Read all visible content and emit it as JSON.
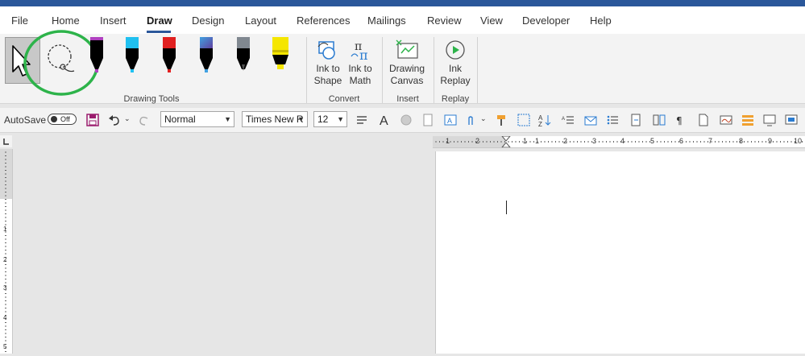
{
  "tabs": [
    "File",
    "Home",
    "Insert",
    "Draw",
    "Design",
    "Layout",
    "References",
    "Mailings",
    "Review",
    "View",
    "Developer",
    "Help"
  ],
  "active_tab": "Draw",
  "ribbon": {
    "groups": {
      "drawing_tools": "Drawing Tools",
      "convert": "Convert",
      "insert": "Insert",
      "replay": "Replay"
    },
    "buttons": {
      "ink_to_shape": [
        "Ink to",
        "Shape"
      ],
      "ink_to_math": [
        "Ink to",
        "Math"
      ],
      "drawing_canvas": [
        "Drawing",
        "Canvas"
      ],
      "ink_replay": [
        "Ink",
        "Replay"
      ]
    },
    "pens": [
      {
        "name": "black-pen",
        "color": "#000000",
        "tip": "#b040c0"
      },
      {
        "name": "cyan-pen",
        "color": "#20c0f0",
        "tip": "#20c0f0"
      },
      {
        "name": "red-pen",
        "color": "#e02020",
        "tip": "#e02020"
      },
      {
        "name": "galaxy-pen",
        "color": "#6050a0",
        "tip": "#40a0e0"
      },
      {
        "name": "pencil",
        "color": "#808890",
        "tip": "#505050"
      },
      {
        "name": "yellow-highlighter",
        "color": "#f5e600",
        "tip": "#f5e600"
      }
    ]
  },
  "qat": {
    "autosave_label": "AutoSave",
    "autosave_state": "Off",
    "style_value": "Normal",
    "font_value": "Times New R",
    "size_value": "12"
  },
  "ruler": {
    "h_labels": [
      "1",
      "2",
      "1",
      "1",
      "2",
      "3",
      "4",
      "5",
      "6",
      "7",
      "8",
      "9",
      "10"
    ],
    "v_labels": [
      "1",
      "2",
      "3",
      "4",
      "5"
    ]
  },
  "colors": {
    "title_bar": "#2b579a",
    "highlight_circle": "#2db34a"
  }
}
